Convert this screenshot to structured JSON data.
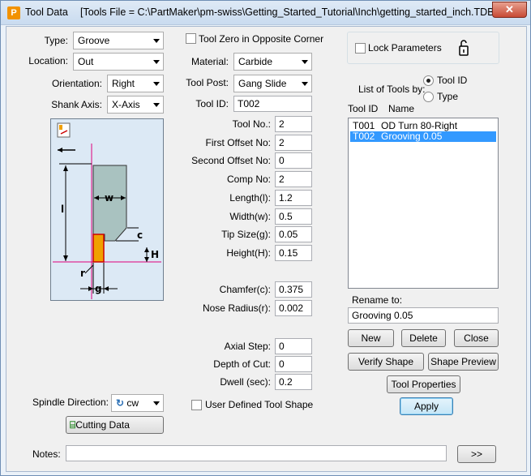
{
  "window": {
    "title": "Tool Data",
    "file_title": "[Tools File = C:\\PartMaker\\pm-swiss\\Getting_Started_Tutorial\\Inch\\getting_started_inch.TDB]"
  },
  "left": {
    "type_label": "Type:",
    "type_value": "Groove",
    "location_label": "Location:",
    "location_value": "Out",
    "orientation_label": "Orientation:",
    "orientation_value": "Right",
    "shank_label": "Shank Axis:",
    "shank_value": "X-Axis",
    "diagram": {
      "w": "w",
      "l": "l",
      "c": "c",
      "H": "H",
      "r": "r",
      "g": "g"
    },
    "spindle_label": "Spindle Direction:",
    "spindle_value": "cw",
    "cutting_data_button": "Cutting Data"
  },
  "middle": {
    "tool_zero_label": "Tool Zero in Opposite Corner",
    "material_label": "Material:",
    "material_value": "Carbide",
    "tool_post_label": "Tool Post:",
    "tool_post_value": "Gang Slide",
    "tool_id_label": "Tool ID:",
    "tool_id_value": "T002",
    "fields": [
      {
        "label": "Tool No.:",
        "value": "2"
      },
      {
        "label": "First Offset No:",
        "value": "2"
      },
      {
        "label": "Second Offset No:",
        "value": "0"
      },
      {
        "label": "Comp No:",
        "value": "2"
      },
      {
        "label": "Length(l):",
        "value": "1.2"
      },
      {
        "label": "Width(w):",
        "value": "0.5"
      },
      {
        "label": "Tip Size(g):",
        "value": "0.05"
      },
      {
        "label": "Height(H):",
        "value": "0.15"
      },
      {
        "label": "Chamfer(c):",
        "value": "0.375"
      },
      {
        "label": "Nose Radius(r):",
        "value": "0.002"
      },
      {
        "label": "Axial Step:",
        "value": "0"
      },
      {
        "label": "Depth of Cut:",
        "value": "0"
      },
      {
        "label": "Dwell (sec):",
        "value": "0.2"
      }
    ],
    "user_defined_label": "User Defined Tool Shape"
  },
  "right": {
    "lock_label": "Lock Parameters",
    "list_by_label": "List of Tools by:",
    "radio_tool_id": "Tool ID",
    "radio_type": "Type",
    "col_id": "Tool ID",
    "col_name": "Name",
    "tools": [
      {
        "id": "T001",
        "name": "OD Turn 80-Right",
        "selected": false
      },
      {
        "id": "T002",
        "name": "Grooving 0.05",
        "selected": true
      }
    ],
    "rename_label": "Rename to:",
    "rename_value": "Grooving 0.05",
    "new_button": "New",
    "delete_button": "Delete",
    "close_button": "Close",
    "verify_button": "Verify Shape",
    "preview_button": "Shape Preview",
    "properties_button": "Tool Properties",
    "apply_button": "Apply"
  },
  "notes": {
    "label": "Notes:",
    "value": "",
    "more_button": ">>"
  }
}
